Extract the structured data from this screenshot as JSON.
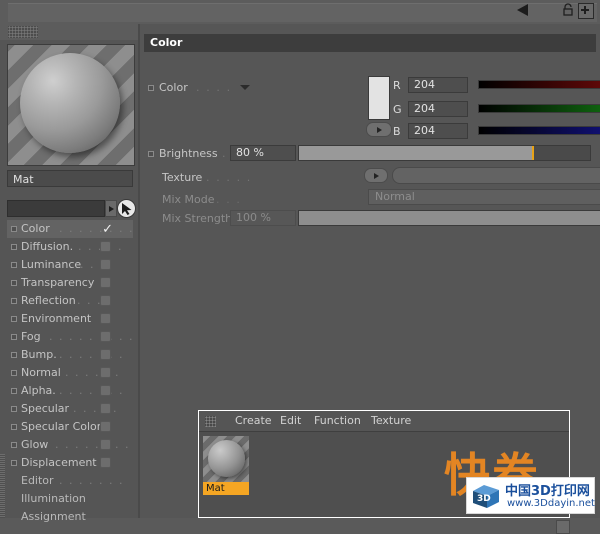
{
  "titlebar": {
    "back_icon": "back-triangle-icon",
    "lock_icon": "lock-icon",
    "maximize_icon": "plus-icon"
  },
  "material": {
    "name_value": "Mat",
    "preview_label": "material-preview-sphere",
    "selector_value": ""
  },
  "channels": [
    {
      "label": "Color",
      "dots": ". . . . . . . . .",
      "checked": true,
      "selected": true,
      "enabled": true
    },
    {
      "label": "Diffusion.",
      "dots": ". . . . .",
      "checked": false,
      "selected": false,
      "enabled": true
    },
    {
      "label": "Luminance",
      "dots": ". . .",
      "checked": false,
      "selected": false,
      "enabled": true
    },
    {
      "label": "Transparency",
      "dots": "",
      "checked": false,
      "selected": false,
      "enabled": true
    },
    {
      "label": "Reflection",
      "dots": ". . . .",
      "checked": false,
      "selected": false,
      "enabled": true
    },
    {
      "label": "Environment",
      "dots": "",
      "checked": false,
      "selected": false,
      "enabled": true
    },
    {
      "label": "Fog",
      "dots": ". . . . . . . . .",
      "checked": false,
      "selected": false,
      "enabled": true
    },
    {
      "label": "Bump.",
      "dots": ". . . . . . .",
      "checked": false,
      "selected": false,
      "enabled": true
    },
    {
      "label": "Normal",
      "dots": ". . . . . .",
      "checked": false,
      "selected": false,
      "enabled": true
    },
    {
      "label": "Alpha.",
      "dots": ". . . . . . .",
      "checked": false,
      "selected": false,
      "enabled": true
    },
    {
      "label": "Specular",
      "dots": ". . . . .",
      "checked": false,
      "selected": false,
      "enabled": true
    },
    {
      "label": "Specular Color",
      "dots": "",
      "checked": false,
      "selected": false,
      "enabled": true
    },
    {
      "label": "Glow",
      "dots": ". . . . . . . .",
      "checked": false,
      "selected": false,
      "enabled": true
    },
    {
      "label": "Displacement",
      "dots": "",
      "checked": false,
      "selected": false,
      "enabled": true
    },
    {
      "label": "Editor",
      "dots": ". . . . . . .",
      "checked": false,
      "selected": false,
      "enabled": false
    },
    {
      "label": "Illumination",
      "dots": "",
      "checked": false,
      "selected": false,
      "enabled": false
    },
    {
      "label": "Assignment",
      "dots": "",
      "checked": false,
      "selected": false,
      "enabled": false
    }
  ],
  "properties": {
    "section_title": "Color",
    "color_row": {
      "label": "Color",
      "dots": ". . . .",
      "swatch_hex": "#e3e3e3",
      "channels": [
        {
          "letter": "R",
          "value": "204",
          "max": 255,
          "bar_color": "#c21010"
        },
        {
          "letter": "G",
          "value": "204",
          "max": 255,
          "bar_color": "#1ec81e"
        },
        {
          "letter": "B",
          "value": "204",
          "max": 255,
          "bar_color": "#2020e6"
        }
      ]
    },
    "brightness_row": {
      "label": "Brightness",
      "dots": ".",
      "value": "80 %",
      "percent": 80,
      "marker_color": "#e8a317"
    },
    "texture_row": {
      "label": "Texture",
      "dots": ". . . . .",
      "value": "",
      "browse_label": "..."
    },
    "mix_mode_row": {
      "label": "Mix Mode",
      "dots": ". . .",
      "value": "Normal"
    },
    "mix_strength_row": {
      "label": "Mix Strength",
      "dots": "",
      "value": "100 %",
      "percent": 100
    }
  },
  "material_manager": {
    "menus": [
      "Create",
      "Edit",
      "Function",
      "Texture"
    ],
    "items": [
      {
        "name": "Mat"
      }
    ]
  },
  "watermark": {
    "big_text": "快卷",
    "title": "中国3D打印网",
    "url": "www.3Ddayin.net",
    "logo_text": "3D"
  }
}
